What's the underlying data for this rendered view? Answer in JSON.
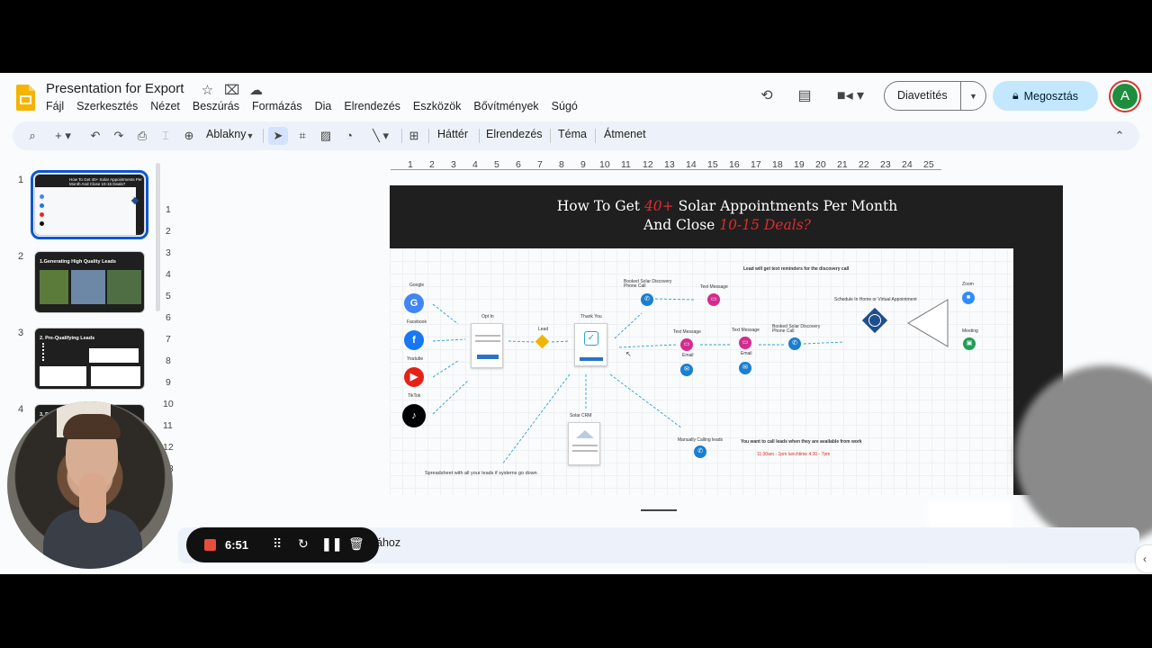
{
  "app": {
    "doc_title": "Presentation for Export",
    "menu": [
      "Fájl",
      "Szerkesztés",
      "Nézet",
      "Beszúrás",
      "Formázás",
      "Dia",
      "Elrendezés",
      "Eszközök",
      "Bővítmények",
      "Súgó"
    ],
    "present_label": "Diavetítés",
    "share_label": "Megosztás",
    "avatar_letter": "A"
  },
  "toolbar": {
    "zoom_label": "Ablakny",
    "background_label": "Háttér",
    "layout_label": "Elrendezés",
    "theme_label": "Téma",
    "transition_label": "Átmenet"
  },
  "filmstrip": {
    "slides": [
      {
        "num": "1",
        "title": "How To Get 40+ Solar Appointments Per Month And Close 10-15 Deals?"
      },
      {
        "num": "2",
        "title": "1.Generating High Quality Leads"
      },
      {
        "num": "3",
        "title": "2. Pre-Qualifying Leads"
      },
      {
        "num": "4",
        "title": "3. D"
      }
    ]
  },
  "ruler": {
    "h": [
      "1",
      "2",
      "3",
      "4",
      "5",
      "6",
      "7",
      "8",
      "9",
      "10",
      "11",
      "12",
      "13",
      "14",
      "15",
      "16",
      "17",
      "18",
      "19",
      "20",
      "21",
      "22",
      "23",
      "24",
      "25"
    ],
    "v": [
      "1",
      "2",
      "3",
      "4",
      "5",
      "6",
      "7",
      "8",
      "9",
      "10",
      "11",
      "12",
      "13"
    ]
  },
  "slide": {
    "title_a": "How To Get ",
    "title_hl1": "40+",
    "title_b": " Solar Appointments Per Month",
    "title_c": "And Close ",
    "title_hl2": "10-15 Deals?",
    "labels": {
      "google": "Google",
      "facebook": "Facebook",
      "youtube": "Youtube",
      "tiktok": "TikTok",
      "optin": "Opt In",
      "lead": "Lead",
      "thankyou": "Thank You",
      "solarcrm": "Solar CRM",
      "booked1": "Booked Solar Discovery Phone Call",
      "textmsg1": "Text Message",
      "reminders": "Lead will get text reminders for the discovery call",
      "textmsg2": "Text Message",
      "email1": "Email",
      "textmsg3": "Text Message",
      "email2": "Email",
      "booked2": "Booked Solar Discovery Phone Call",
      "schedule": "Schedule In Home or Virtual Appointment",
      "zoom": "Zoom",
      "meeting": "Meeting",
      "manual": "Manually Calling leads",
      "callwhen": "You want to call leads when they are available from work",
      "times": "11:30am - 1pm lunchtime 4:30 - 7pm",
      "spreadsheet": "Spreadsheet with all your leads if systems go down"
    }
  },
  "notes": {
    "text": "ához"
  },
  "recorder": {
    "time": "6:51"
  },
  "colors": {
    "brand_yellow": "#f4b400",
    "share_bg": "#c2e7ff",
    "selected_blue": "#0b57d0",
    "accent_red": "#e02b2b"
  }
}
